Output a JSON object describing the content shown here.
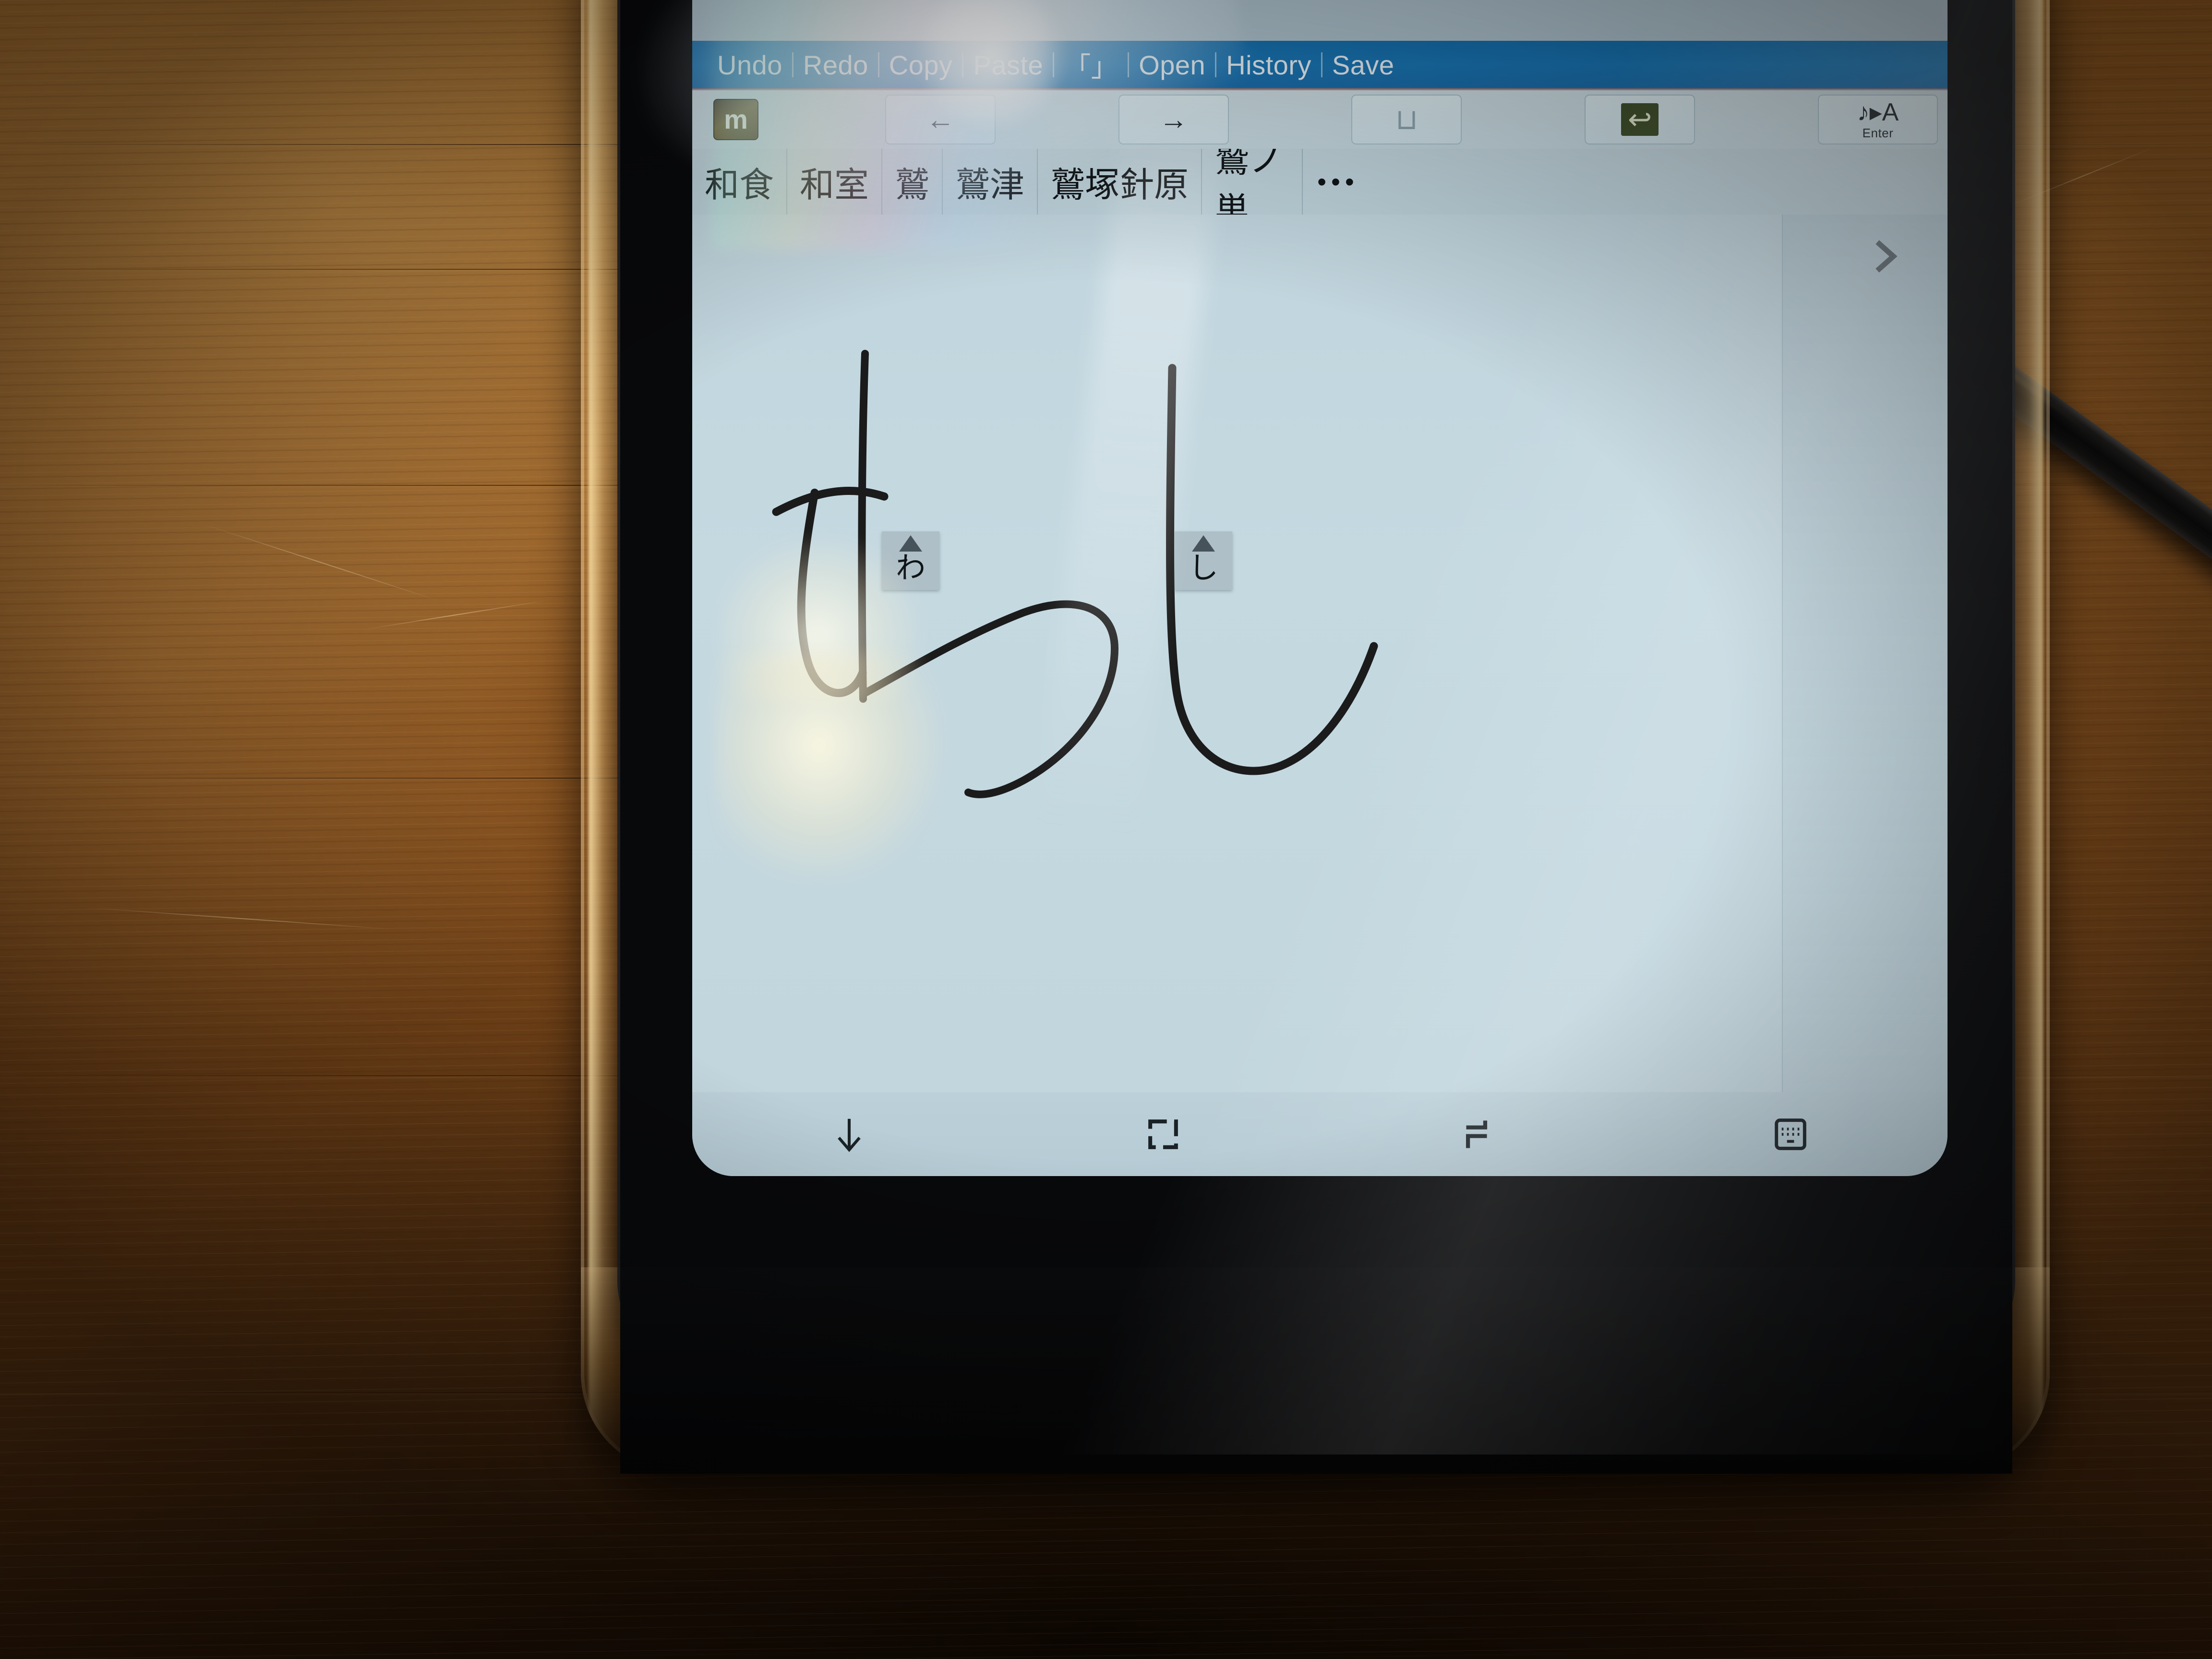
{
  "scene": {
    "description": "Samsung Galaxy Note smartphone in a clear case on a wooden table with an S-Pen stylus, showing the mazec Japanese handwriting IME"
  },
  "toolbar": {
    "items": [
      {
        "label": "Undo",
        "name": "undo"
      },
      {
        "label": "Redo",
        "name": "redo"
      },
      {
        "label": "Copy",
        "name": "copy"
      },
      {
        "label": "Paste",
        "name": "paste"
      },
      {
        "label": "「」",
        "name": "brackets"
      },
      {
        "label": "Open",
        "name": "open"
      },
      {
        "label": "History",
        "name": "history"
      },
      {
        "label": "Save",
        "name": "save"
      }
    ]
  },
  "keyrow": {
    "ime_icon_letter": "m",
    "keys": [
      {
        "name": "ime-app",
        "glyph": "",
        "sub": ""
      },
      {
        "name": "cursor-left",
        "glyph": "←",
        "sub": ""
      },
      {
        "name": "cursor-right",
        "glyph": "→",
        "sub": ""
      },
      {
        "name": "space",
        "glyph": "⊔",
        "sub": ""
      },
      {
        "name": "backspace",
        "glyph": "↩",
        "sub": ""
      },
      {
        "name": "enter",
        "glyph": "♪▸A",
        "sub": "Enter"
      }
    ]
  },
  "candidates": {
    "items": [
      "和食",
      "和室",
      "鷲",
      "鷲津",
      "鷲塚針原",
      "鷲ノ巣"
    ],
    "overflow": "•••"
  },
  "writing_area": {
    "handwritten_text": "わし",
    "recognized_tags": [
      "わ",
      "し"
    ],
    "next_chevron": "›"
  },
  "navbar": {
    "buttons": [
      {
        "name": "hide-keyboard",
        "glyph": "↓"
      },
      {
        "name": "home",
        "glyph": "□"
      },
      {
        "name": "recents",
        "glyph": "┐"
      },
      {
        "name": "keyboard-switch",
        "glyph": "⌨"
      }
    ]
  },
  "colors": {
    "toolbar_blue": "#1673b4",
    "screen_bg": "#c1d5de",
    "candidate_bg": "#c3d6de",
    "tag_bg": "#aebfc7",
    "wood": "#8a5420",
    "stylus": "#121212"
  }
}
